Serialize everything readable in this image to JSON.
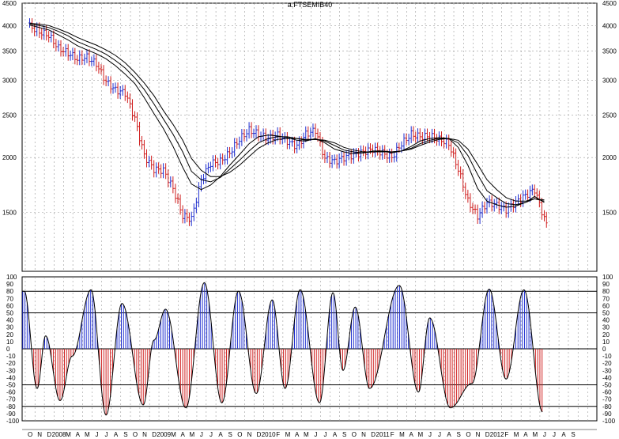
{
  "title": "a.FTSEMIB40",
  "chart_data": [
    {
      "type": "bar",
      "panel": "price",
      "title": "a.FTSEMIB40",
      "scale": "log",
      "ylim": [
        1100,
        4500
      ],
      "yticks": [
        1500,
        2000,
        2500,
        3000,
        3500,
        4000,
        4500
      ],
      "grid": true,
      "colors": {
        "up": "#1f2fd0",
        "down": "#d01f1f",
        "ma": "#000000"
      },
      "bar_months": [
        "2007-10",
        "2007-11",
        "2007-12",
        "2008-01",
        "2008-02",
        "2008-03",
        "2008-04",
        "2008-05",
        "2008-06",
        "2008-07",
        "2008-08",
        "2008-09",
        "2008-10",
        "2008-11",
        "2008-12",
        "2009-01",
        "2009-02",
        "2009-03",
        "2009-04",
        "2009-05",
        "2009-06",
        "2009-07",
        "2009-08",
        "2009-09",
        "2009-10",
        "2009-11",
        "2009-12",
        "2010-01",
        "2010-02",
        "2010-03",
        "2010-04",
        "2010-05",
        "2010-06",
        "2010-07",
        "2010-08",
        "2010-09",
        "2010-10",
        "2010-11",
        "2010-12",
        "2011-01",
        "2011-02",
        "2011-03",
        "2011-04",
        "2011-05",
        "2011-06",
        "2011-07",
        "2011-08",
        "2011-09",
        "2011-10",
        "2011-11",
        "2011-12",
        "2012-01",
        "2012-02",
        "2012-03",
        "2012-04"
      ],
      "close": [
        3990,
        3870,
        3800,
        3550,
        3460,
        3360,
        3390,
        3270,
        2980,
        2850,
        2810,
        2450,
        2020,
        1880,
        1870,
        1700,
        1470,
        1450,
        1780,
        1940,
        1960,
        2050,
        2200,
        2310,
        2260,
        2210,
        2250,
        2180,
        2120,
        2260,
        2310,
        1990,
        1960,
        2000,
        2030,
        2060,
        2090,
        2050,
        2000,
        2150,
        2260,
        2230,
        2240,
        2200,
        2150,
        1880,
        1590,
        1470,
        1580,
        1560,
        1520,
        1580,
        1640,
        1690,
        1450
      ],
      "moving_averages": [
        {
          "values": [
            4010,
            3960,
            3910,
            3810,
            3710,
            3600,
            3520,
            3450,
            3360,
            3240,
            3100,
            2950,
            2740,
            2520,
            2330,
            2120,
            1900,
            1740,
            1690,
            1730,
            1810,
            1920,
            2030,
            2150,
            2230,
            2250,
            2240,
            2220,
            2190,
            2180,
            2210,
            2160,
            2090,
            2060,
            2040,
            2050,
            2070,
            2070,
            2050,
            2070,
            2120,
            2180,
            2210,
            2220,
            2210,
            2110,
            1920,
            1700,
            1590,
            1560,
            1540,
            1550,
            1580,
            1630,
            1580
          ]
        },
        {
          "values": [
            4030,
            4000,
            3960,
            3880,
            3790,
            3680,
            3600,
            3530,
            3440,
            3330,
            3200,
            3040,
            2860,
            2650,
            2450,
            2260,
            2060,
            1860,
            1780,
            1760,
            1800,
            1880,
            1970,
            2070,
            2160,
            2210,
            2230,
            2230,
            2210,
            2190,
            2200,
            2180,
            2130,
            2080,
            2060,
            2050,
            2060,
            2070,
            2060,
            2070,
            2100,
            2150,
            2190,
            2210,
            2210,
            2160,
            2020,
            1830,
            1680,
            1620,
            1570,
            1560,
            1580,
            1610,
            1590
          ]
        },
        {
          "values": [
            4050,
            4030,
            4000,
            3930,
            3850,
            3760,
            3680,
            3610,
            3520,
            3420,
            3290,
            3130,
            2960,
            2770,
            2560,
            2380,
            2190,
            1990,
            1870,
            1810,
            1810,
            1850,
            1920,
            2010,
            2100,
            2160,
            2200,
            2210,
            2210,
            2200,
            2200,
            2190,
            2160,
            2110,
            2080,
            2060,
            2060,
            2060,
            2060,
            2070,
            2090,
            2130,
            2170,
            2200,
            2210,
            2190,
            2090,
            1930,
            1780,
            1690,
            1620,
            1590,
            1590,
            1610,
            1600
          ]
        }
      ]
    },
    {
      "type": "area",
      "panel": "oscillator",
      "ylim": [
        -100,
        100
      ],
      "yticks": [
        100,
        90,
        80,
        70,
        60,
        50,
        40,
        30,
        20,
        10,
        0,
        -10,
        -20,
        -30,
        -40,
        -50,
        -60,
        -70,
        -80,
        -90,
        -100
      ],
      "reference_lines": [
        80,
        50,
        0,
        -50,
        -80
      ],
      "colors": {
        "positive": "#1f2fd0",
        "negative": "#d01f1f",
        "line": "#000000"
      },
      "peaks": [
        {
          "date": "2007-09-28",
          "value": 80
        },
        {
          "date": "2007-11-08",
          "value": -55
        },
        {
          "date": "2007-12-05",
          "value": 18
        },
        {
          "date": "2008-01-20",
          "value": -72
        },
        {
          "date": "2008-02-28",
          "value": -10
        },
        {
          "date": "2008-04-28",
          "value": 82
        },
        {
          "date": "2008-06-15",
          "value": -92
        },
        {
          "date": "2008-08-05",
          "value": 63
        },
        {
          "date": "2008-10-12",
          "value": -78
        },
        {
          "date": "2008-11-15",
          "value": 12
        },
        {
          "date": "2008-12-22",
          "value": 55
        },
        {
          "date": "2009-02-25",
          "value": -82
        },
        {
          "date": "2009-04-25",
          "value": 92
        },
        {
          "date": "2009-06-20",
          "value": -75
        },
        {
          "date": "2009-08-12",
          "value": 80
        },
        {
          "date": "2009-10-08",
          "value": -62
        },
        {
          "date": "2009-11-28",
          "value": 68
        },
        {
          "date": "2010-01-08",
          "value": -55
        },
        {
          "date": "2010-02-25",
          "value": 82
        },
        {
          "date": "2010-04-28",
          "value": -75
        },
        {
          "date": "2010-06-10",
          "value": 78
        },
        {
          "date": "2010-07-12",
          "value": -30
        },
        {
          "date": "2010-08-20",
          "value": 58
        },
        {
          "date": "2010-10-05",
          "value": -55
        },
        {
          "date": "2011-01-08",
          "value": 88
        },
        {
          "date": "2011-03-10",
          "value": -60
        },
        {
          "date": "2011-04-15",
          "value": 43
        },
        {
          "date": "2011-06-20",
          "value": -82
        },
        {
          "date": "2011-08-28",
          "value": -48
        },
        {
          "date": "2011-10-22",
          "value": 83
        },
        {
          "date": "2011-12-15",
          "value": -42
        },
        {
          "date": "2012-02-10",
          "value": 82
        },
        {
          "date": "2012-04-10",
          "value": -88
        }
      ]
    }
  ],
  "x_axis": {
    "start": "2007-09-21",
    "end": "2012-09-30",
    "month_labels": [
      "O",
      "N",
      "D",
      "2008",
      "M",
      "A",
      "M",
      "J",
      "J",
      "A",
      "S",
      "O",
      "N",
      "D",
      "2009",
      "M",
      "A",
      "M",
      "J",
      "J",
      "A",
      "S",
      "O",
      "N",
      "D",
      "2010",
      "F",
      "M",
      "A",
      "M",
      "J",
      "J",
      "A",
      "S",
      "O",
      "N",
      "D",
      "2011",
      "F",
      "M",
      "A",
      "M",
      "J",
      "J",
      "A",
      "S",
      "O",
      "N",
      "D",
      "2012",
      "F",
      "M",
      "A",
      "M",
      "J",
      "J",
      "A",
      "S"
    ]
  }
}
